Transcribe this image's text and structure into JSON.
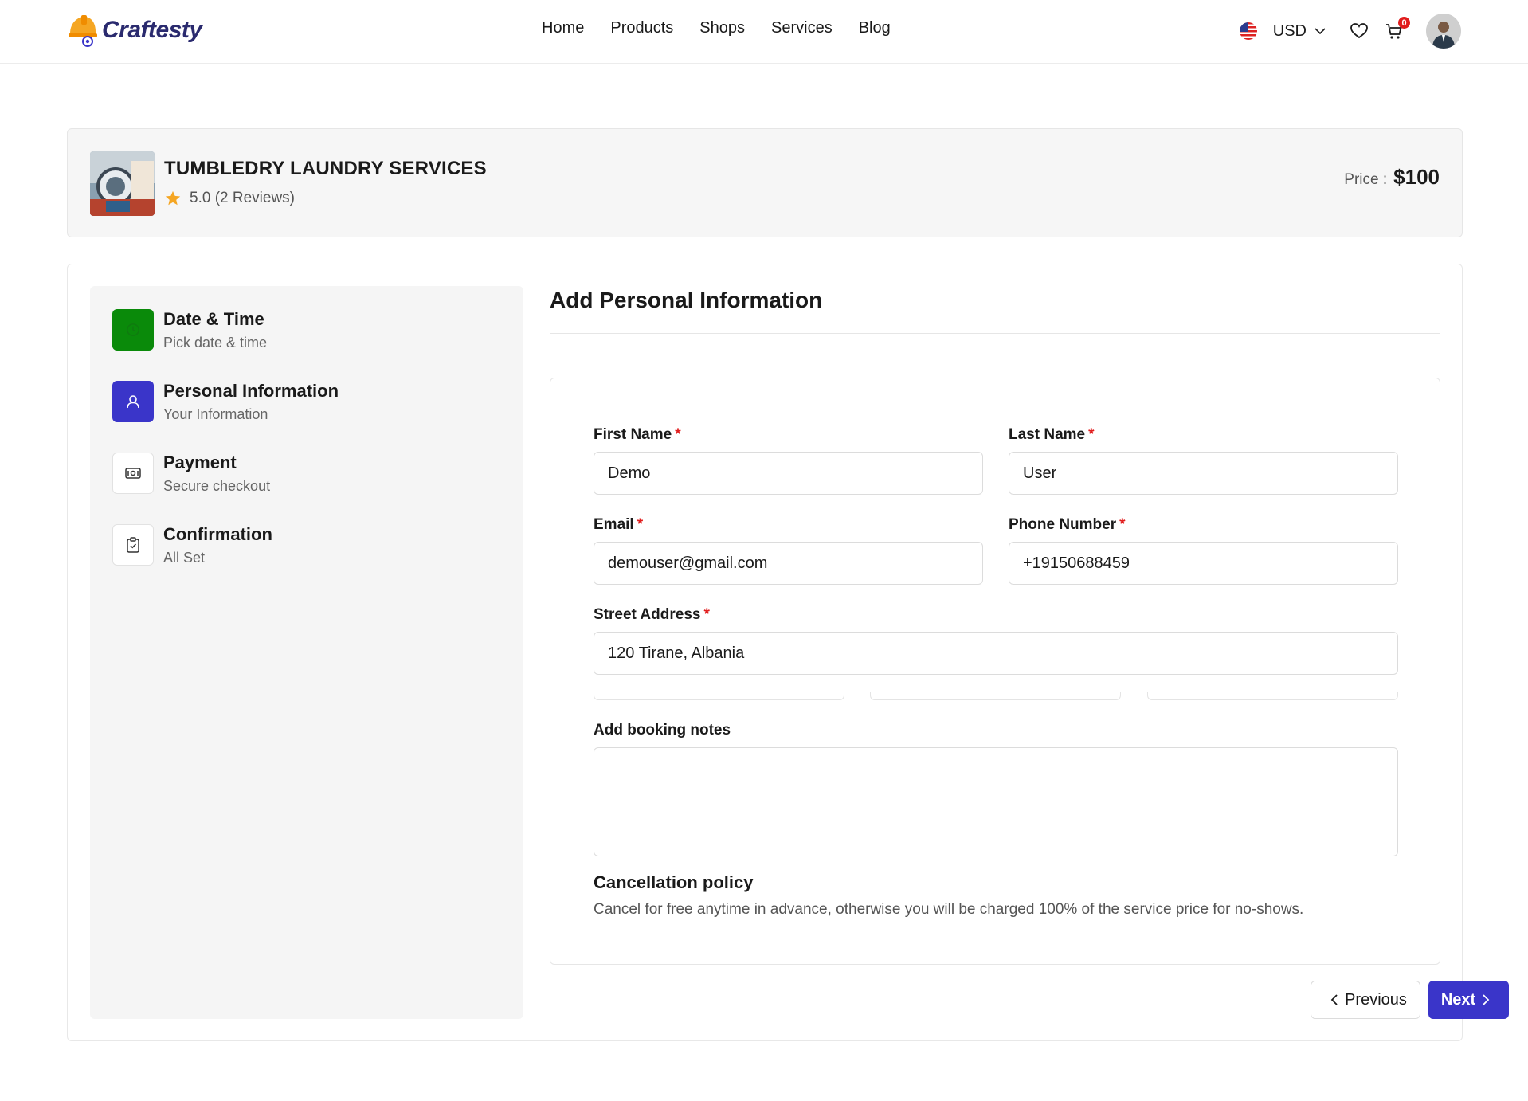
{
  "header": {
    "brand": "Craftesty",
    "nav": [
      "Home",
      "Products",
      "Shops",
      "Services",
      "Blog"
    ],
    "currency": "USD",
    "cart_count": "0"
  },
  "service": {
    "title": "TUMBLEDRY LAUNDRY SERVICES",
    "rating": "5.0 (2 Reviews)",
    "price_label": "Price :",
    "price": "$100"
  },
  "steps": [
    {
      "title": "Date & Time",
      "subtitle": "Pick date & time",
      "icon": "clock-icon",
      "state": "completed",
      "color": "#0a8a0a"
    },
    {
      "title": "Personal Information",
      "subtitle": "Your Information",
      "icon": "user-icon",
      "state": "active",
      "color": "#3a35c9"
    },
    {
      "title": "Payment",
      "subtitle": "Secure checkout",
      "icon": "money-icon",
      "state": "pending"
    },
    {
      "title": "Confirmation",
      "subtitle": "All Set",
      "icon": "clipboard-check-icon",
      "state": "pending"
    }
  ],
  "form": {
    "heading": "Add Personal Information",
    "first_name": {
      "label": "First Name",
      "value": "Demo"
    },
    "last_name": {
      "label": "Last Name",
      "value": "User"
    },
    "email": {
      "label": "Email",
      "value": "demouser@gmail.com"
    },
    "phone": {
      "label": "Phone Number",
      "value": "+19150688459"
    },
    "street": {
      "label": "Street Address",
      "value": "120 Tirane, Albania"
    },
    "notes": {
      "label": "Add booking notes",
      "value": ""
    },
    "required_mark": "*"
  },
  "policy": {
    "title": "Cancellation policy",
    "text": "Cancel for free anytime in advance, otherwise you will be charged 100% of the service price for no-shows."
  },
  "actions": {
    "previous": "Previous",
    "next": "Next"
  },
  "colors": {
    "accent": "#3a35c9",
    "completed": "#0a8a0a",
    "required": "#e11d1d"
  }
}
